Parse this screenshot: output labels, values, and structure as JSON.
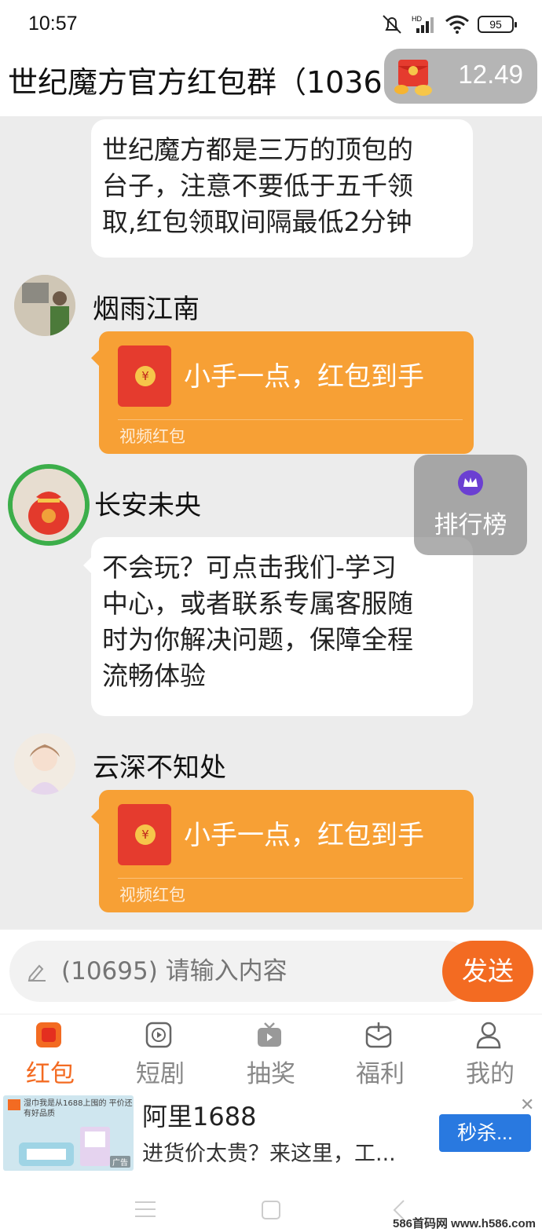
{
  "status_bar": {
    "time": "10:57",
    "battery": "95"
  },
  "header": {
    "title": "世纪魔方官方红包群（1036",
    "redbag_amount": "12.49"
  },
  "messages": [
    {
      "type": "text",
      "text_lines": [
        "世纪魔方都是三万的顶包的",
        "台子，注意不要低于五千领",
        "取,红包领取间隔最低2分钟"
      ]
    },
    {
      "type": "redpacket",
      "sender": "烟雨江南",
      "label": "小手一点，红包到手",
      "footer": "视频红包"
    },
    {
      "type": "text",
      "sender": "长安未央",
      "text_lines": [
        "不会玩？可点击我们-学习",
        "中心，或者联系专属客服随",
        "时为你解决问题，保障全程",
        "流畅体验"
      ]
    },
    {
      "type": "redpacket",
      "sender": "云深不知处",
      "label": "小手一点，红包到手",
      "footer": "视频红包"
    }
  ],
  "ranking": {
    "label": "排行榜"
  },
  "input": {
    "placeholder": "(10695) 请输入内容",
    "send_label": "发送"
  },
  "tabs": [
    {
      "label": "红包",
      "icon": "redpacket-icon",
      "active": true
    },
    {
      "label": "短剧",
      "icon": "play-icon",
      "active": false
    },
    {
      "label": "抽奖",
      "icon": "tv-icon",
      "active": false
    },
    {
      "label": "福利",
      "icon": "gift-icon",
      "active": false
    },
    {
      "label": "我的",
      "icon": "user-icon",
      "active": false
    }
  ],
  "ad": {
    "thumb_caption": "湿巾我是从1688上囤的 平价还有好品质",
    "thumb_tag": "广告",
    "title": "阿里1688",
    "desc": "进货价太贵？来这里，工...",
    "button": "秒杀..."
  },
  "watermark": "586首码网 www.h586.com",
  "colors": {
    "accent": "#f36b22",
    "redpacket_bg": "#f7a035",
    "chat_bg": "#ececec"
  }
}
